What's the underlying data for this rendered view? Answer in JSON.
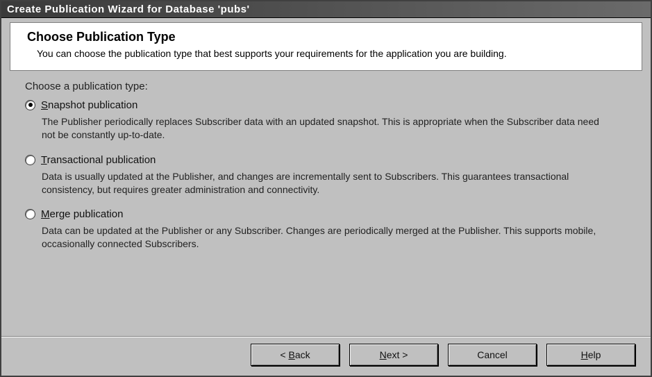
{
  "window": {
    "title": "Create Publication Wizard for Database 'pubs'"
  },
  "header": {
    "title": "Choose Publication Type",
    "subtitle": "You can choose the publication type that best supports your requirements for the application you are building."
  },
  "content": {
    "prompt": "Choose a publication type:",
    "options": [
      {
        "id": "snapshot",
        "selected": true,
        "mnemonic": "S",
        "rest": "napshot publication",
        "description": "The Publisher periodically replaces Subscriber data with an updated snapshot. This is appropriate when the Subscriber data need not be constantly up-to-date."
      },
      {
        "id": "transactional",
        "selected": false,
        "mnemonic": "T",
        "rest": "ransactional publication",
        "description": "Data is usually updated at the Publisher, and changes are incrementally sent to Subscribers. This guarantees transactional consistency, but requires greater administration and connectivity."
      },
      {
        "id": "merge",
        "selected": false,
        "mnemonic": "M",
        "rest": "erge publication",
        "description": "Data can be updated at the Publisher or any Subscriber. Changes are periodically merged at the Publisher. This supports mobile, occasionally connected Subscribers."
      }
    ]
  },
  "buttons": {
    "back": {
      "prefix": "< ",
      "mnemonic": "B",
      "rest": "ack"
    },
    "next": {
      "prefix": "",
      "mnemonic": "N",
      "rest": "ext >"
    },
    "cancel": {
      "label": "Cancel"
    },
    "help": {
      "prefix": "",
      "mnemonic": "H",
      "rest": "elp"
    }
  }
}
